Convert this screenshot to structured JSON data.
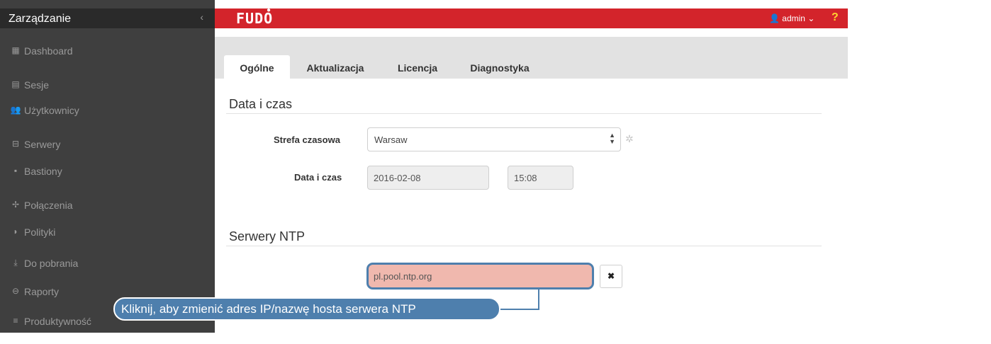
{
  "sidebar": {
    "title": "Zarządzanie",
    "collapse_glyph": "‹",
    "items": [
      {
        "label": "Dashboard",
        "icon": "▦"
      },
      {
        "label": "Sesje",
        "icon": "▤"
      },
      {
        "label": "Użytkownicy",
        "icon": "👥"
      },
      {
        "label": "Serwery",
        "icon": "⊟"
      },
      {
        "label": "Bastiony",
        "icon": "▪"
      },
      {
        "label": "Połączenia",
        "icon": "✢"
      },
      {
        "label": "Polityki",
        "icon": "◗"
      },
      {
        "label": "Do pobrania",
        "icon": "⤓"
      },
      {
        "label": "Raporty",
        "icon": "⊖"
      },
      {
        "label": "Produktywność",
        "icon": "≡"
      }
    ]
  },
  "header": {
    "logo": "FUDO",
    "user": "admin",
    "user_icon": "👤",
    "user_caret": "⌄",
    "help": "?",
    "brand_color": "#d3242b"
  },
  "tabs": [
    {
      "label": "Ogólne",
      "active": true
    },
    {
      "label": "Aktualizacja",
      "active": false
    },
    {
      "label": "Licencja",
      "active": false
    },
    {
      "label": "Diagnostyka",
      "active": false
    }
  ],
  "datetime_section": {
    "title": "Data i czas",
    "timezone_label": "Strefa czasowa",
    "timezone_value": "Warsaw",
    "datetime_label": "Data i czas",
    "date_value": "2016-02-08",
    "time_value": "15:08"
  },
  "ntp_section": {
    "title": "Serwery NTP",
    "server_value": "pl.pool.ntp.org",
    "remove_glyph": "✖"
  },
  "callout": {
    "text": "Kliknij, aby zmienić adres IP/nazwę hosta serwera NTP",
    "color": "#4e7fad"
  }
}
